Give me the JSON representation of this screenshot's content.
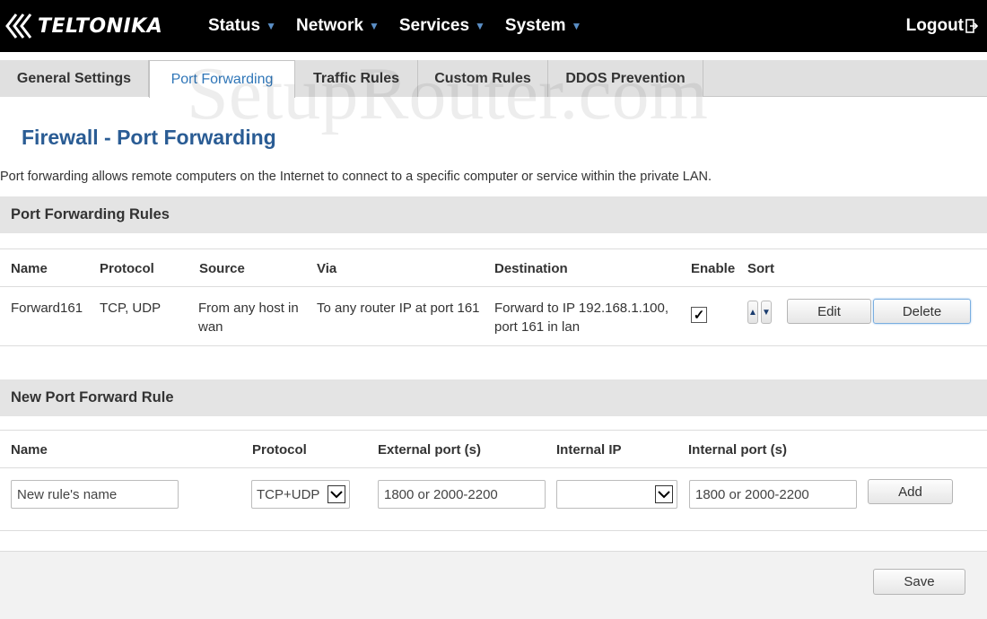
{
  "brand": {
    "logo_text": "TELTONIKA"
  },
  "nav": {
    "items": [
      {
        "label": "Status"
      },
      {
        "label": "Network"
      },
      {
        "label": "Services"
      },
      {
        "label": "System"
      }
    ],
    "logout_label": "Logout"
  },
  "tabs": [
    {
      "label": "General Settings",
      "active": false
    },
    {
      "label": "Port Forwarding",
      "active": true
    },
    {
      "label": "Traffic Rules",
      "active": false
    },
    {
      "label": "Custom Rules",
      "active": false
    },
    {
      "label": "DDOS Prevention",
      "active": false
    }
  ],
  "watermark": "SetupRouter.com",
  "page": {
    "title": "Firewall - Port Forwarding",
    "description": "Port forwarding allows remote computers on the Internet to connect to a specific computer or service within the private LAN."
  },
  "rules_section": {
    "title": "Port Forwarding Rules",
    "columns": [
      "Name",
      "Protocol",
      "Source",
      "Via",
      "Destination",
      "Enable",
      "Sort"
    ],
    "rows": [
      {
        "name": "Forward161",
        "protocol": "TCP, UDP",
        "source_line1": "From any host in",
        "source_line2": "wan",
        "via": "To any router IP at port 161",
        "destination_line1": "Forward to IP 192.168.1.100,",
        "destination_line2": "port 161 in lan",
        "enabled": true,
        "edit_label": "Edit",
        "delete_label": "Delete"
      }
    ]
  },
  "new_rule_section": {
    "title": "New Port Forward Rule",
    "columns": [
      "Name",
      "Protocol",
      "External port (s)",
      "Internal IP",
      "Internal port (s)"
    ],
    "name_placeholder": "New rule's name",
    "protocol_value": "TCP+UDP",
    "external_port_placeholder": "1800 or 2000-2200",
    "internal_ip_value": "",
    "internal_port_placeholder": "1800 or 2000-2200",
    "add_label": "Add"
  },
  "footer": {
    "save_label": "Save"
  },
  "colors": {
    "topbar_bg": "#000000",
    "nav_caret": "#5b8fc6",
    "title_blue": "#2a5c94",
    "active_tab_text": "#2f76b8"
  }
}
